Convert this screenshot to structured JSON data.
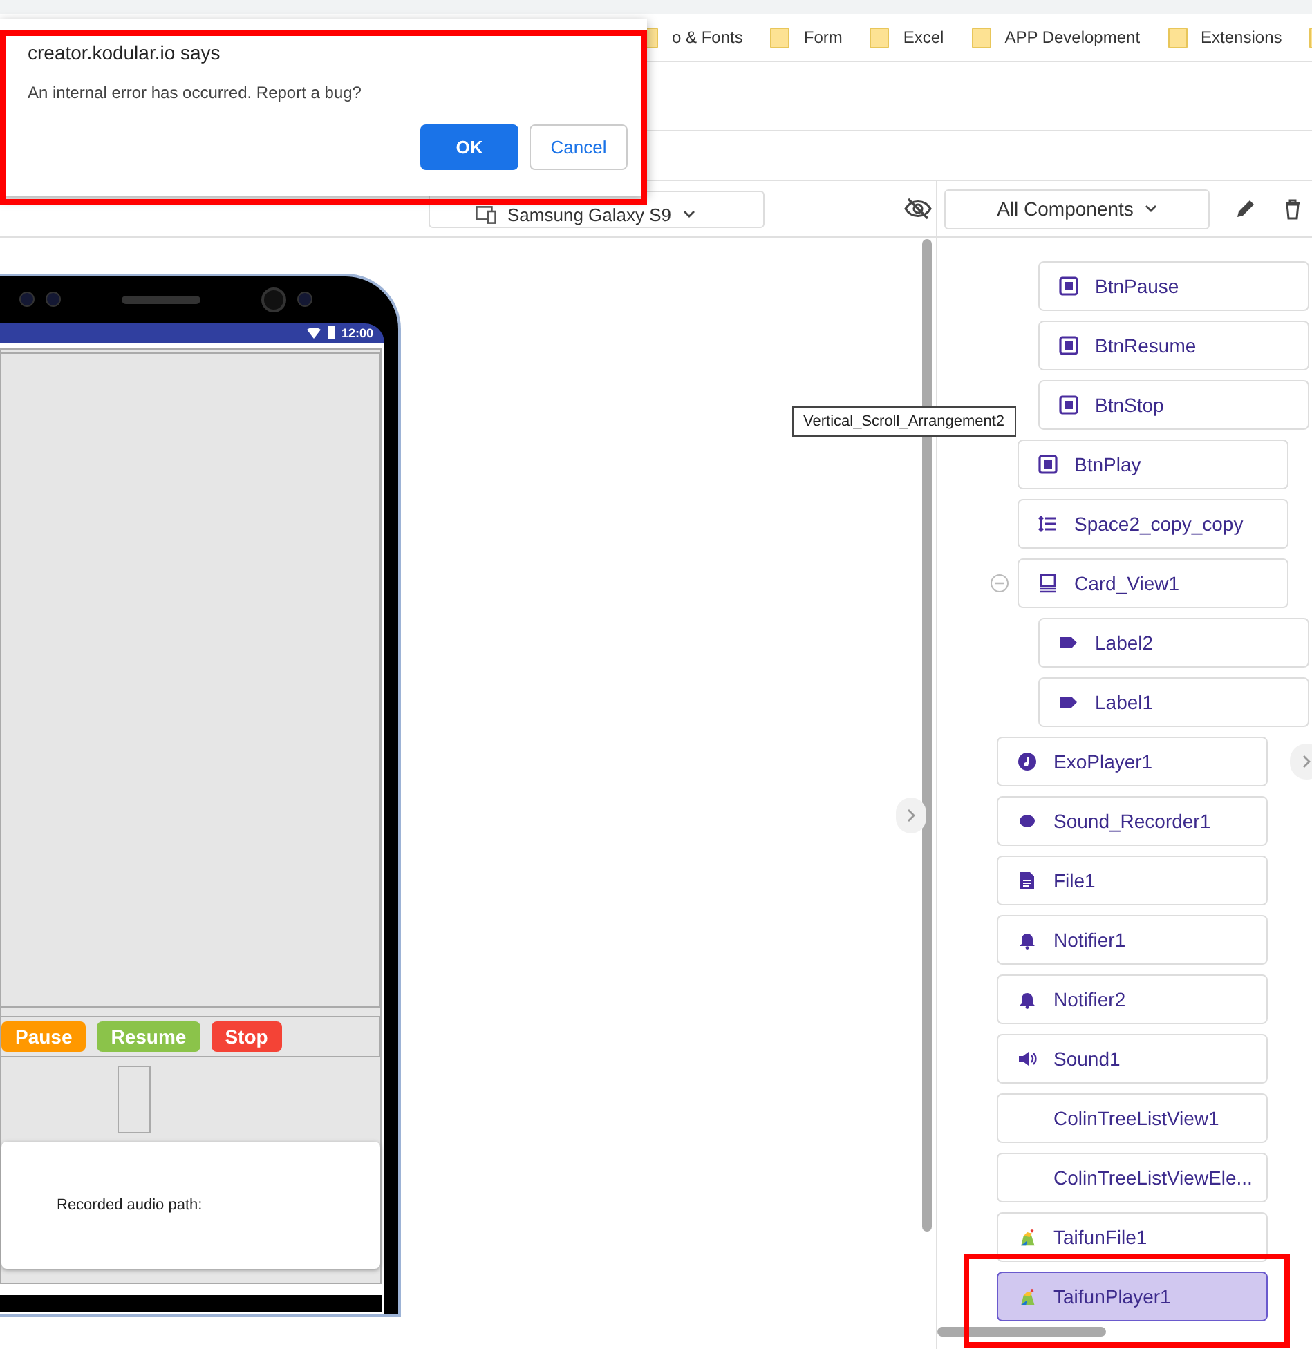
{
  "bookmarks": [
    {
      "label": "o & Fonts"
    },
    {
      "label": "Form"
    },
    {
      "label": "Excel"
    },
    {
      "label": "APP Development"
    },
    {
      "label": "Extensions"
    }
  ],
  "dialog": {
    "title": "creator.kodular.io says",
    "message": "An internal error has occurred. Report a bug?",
    "buttons": [
      {
        "label": "OK",
        "kind": "primary"
      },
      {
        "label": "Cancel",
        "kind": "secondary"
      }
    ]
  },
  "viewer": {
    "device": "Samsung Galaxy S9",
    "status_time": "12:00",
    "buttons": [
      {
        "label": "Pause",
        "color": "#ff9800"
      },
      {
        "label": "Resume",
        "color": "#8bc34a"
      },
      {
        "label": "Stop",
        "color": "#f44336"
      }
    ],
    "card_text": "Recorded audio path:"
  },
  "tooltip": "Vertical_Scroll_Arrangement2",
  "components_panel": {
    "filter": "All Components",
    "items": [
      {
        "children": [
          {
            "children": [
              {
                "name": "BtnPause",
                "kind": "button",
                "selected": false
              },
              {
                "name": "BtnResume",
                "kind": "button",
                "selected": false
              },
              {
                "name": "BtnStop",
                "kind": "button",
                "selected": false
              }
            ]
          },
          {
            "name": "BtnPlay",
            "kind": "button",
            "selected": false
          },
          {
            "name": "Space2_copy_copy",
            "kind": "space",
            "selected": false
          },
          {
            "name": "Card_View1",
            "kind": "card",
            "selected": false,
            "expanded": true,
            "children": [
              {
                "name": "Label2",
                "kind": "label",
                "selected": false
              },
              {
                "name": "Label1",
                "kind": "label",
                "selected": false
              }
            ]
          }
        ]
      },
      {
        "name": "ExoPlayer1",
        "kind": "player",
        "selected": false
      },
      {
        "name": "Sound_Recorder1",
        "kind": "recorder",
        "selected": false
      },
      {
        "name": "File1",
        "kind": "file",
        "selected": false
      },
      {
        "name": "Notifier1",
        "kind": "notifier",
        "selected": false
      },
      {
        "name": "Notifier2",
        "kind": "notifier",
        "selected": false
      },
      {
        "name": "Sound1",
        "kind": "sound",
        "selected": false
      },
      {
        "name": "ColinTreeListView1",
        "kind": "extension",
        "selected": false
      },
      {
        "name": "ColinTreeListViewEle...",
        "kind": "extension",
        "selected": false
      },
      {
        "name": "TaifunFile1",
        "kind": "taifun",
        "selected": false
      },
      {
        "name": "TaifunPlayer1",
        "kind": "taifun",
        "selected": true
      }
    ]
  }
}
